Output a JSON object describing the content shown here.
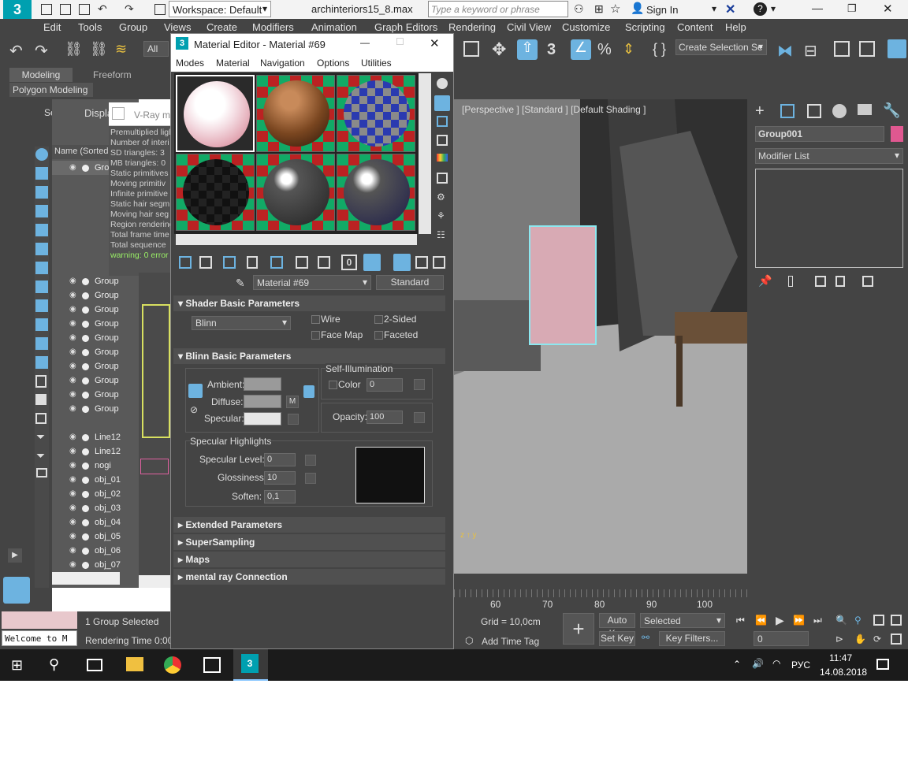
{
  "title_bar": {
    "workspace": "Workspace: Default",
    "file_name": "archinteriors15_8.max",
    "search_placeholder": "Type a keyword or phrase",
    "sign_in": "Sign In"
  },
  "menu": [
    "Edit",
    "Tools",
    "Group",
    "Views",
    "Create",
    "Modifiers",
    "Animation",
    "Graph Editors",
    "Rendering",
    "Civil View",
    "Customize",
    "Scripting",
    "Content",
    "Help"
  ],
  "toolbar": {
    "filter": "All",
    "selection_set_placeholder": "Create Selection Se"
  },
  "ribbon": {
    "tabs": [
      "Modeling",
      "Freeform"
    ],
    "sub": "Polygon Modeling"
  },
  "scene_explorer": {
    "tabs": [
      "Select",
      "Displa"
    ],
    "column_header": "Name (Sorted",
    "rows": [
      "Grou",
      "Group",
      "Group",
      "Group",
      "Group",
      "Group",
      "Group",
      "Group",
      "Group",
      "Group",
      "Group",
      "Line12",
      "Line12",
      "nogi",
      "obj_01",
      "obj_02",
      "obj_03",
      "obj_04",
      "obj_05",
      "obj_06",
      "obj_07"
    ]
  },
  "vray_log": {
    "title": "V-Ray m",
    "lines": [
      "Premultiplied ligh",
      "Number of interi",
      "SD triangles: 3",
      "MB triangles: 0",
      "Static primitives",
      "Moving primitiv",
      "Infinite primitive",
      "Static hair segm",
      "Moving hair seg",
      "Region rendering",
      "Total frame time",
      "Total sequence",
      "warning: 0 error"
    ]
  },
  "viewport": {
    "label": "[Perspective ] [Standard ] [Default Shading ]"
  },
  "command_panel": {
    "object_name": "Group001",
    "object_color": "#e05890",
    "modifier_list": "Modifier List"
  },
  "timeline": {
    "ticks": [
      "60",
      "70",
      "80",
      "90",
      "100"
    ]
  },
  "status": {
    "selection": "1 Group Selected",
    "rendering_time": "Rendering Time 0:00:",
    "maxscript": "Welcome to M",
    "grid": "Grid = 10,0cm",
    "add_time_tag": "Add Time Tag",
    "auto_key": "Auto Key",
    "set_key": "Set Key",
    "key_mode": "Selected",
    "key_filters": "Key Filters...",
    "frame": "0"
  },
  "taskbar": {
    "lang": "РУС",
    "time": "11:47",
    "date": "14.08.2018"
  },
  "material_editor": {
    "title": "Material Editor - Material #69",
    "menus": [
      "Modes",
      "Material",
      "Navigation",
      "Options",
      "Utilities"
    ],
    "material_name": "Material #69",
    "material_type": "Standard",
    "rollouts": {
      "shader_basic": "Shader Basic Parameters",
      "shader": "Blinn",
      "wire": "Wire",
      "two_sided": "2-Sided",
      "face_map": "Face Map",
      "faceted": "Faceted",
      "blinn_basic": "Blinn Basic Parameters",
      "self_illum": "Self-Illumination",
      "color": "Color",
      "color_value": "0",
      "ambient": "Ambient:",
      "diffuse": "Diffuse:",
      "specular": "Specular:",
      "m_button": "M",
      "opacity": "Opacity:",
      "opacity_value": "100",
      "spec_highlights": "Specular Highlights",
      "spec_level": "Specular Level:",
      "spec_level_value": "0",
      "glossiness": "Glossiness:",
      "glossiness_value": "10",
      "soften": "Soften:",
      "soften_value": "0,1",
      "extended": "Extended Parameters",
      "supersampling": "SuperSampling",
      "maps": "Maps",
      "mental_ray": "mental ray Connection"
    },
    "colors": {
      "ambient": "#9a9a9a",
      "diffuse": "#9a9a9a",
      "specular": "#e6e6e6"
    }
  }
}
